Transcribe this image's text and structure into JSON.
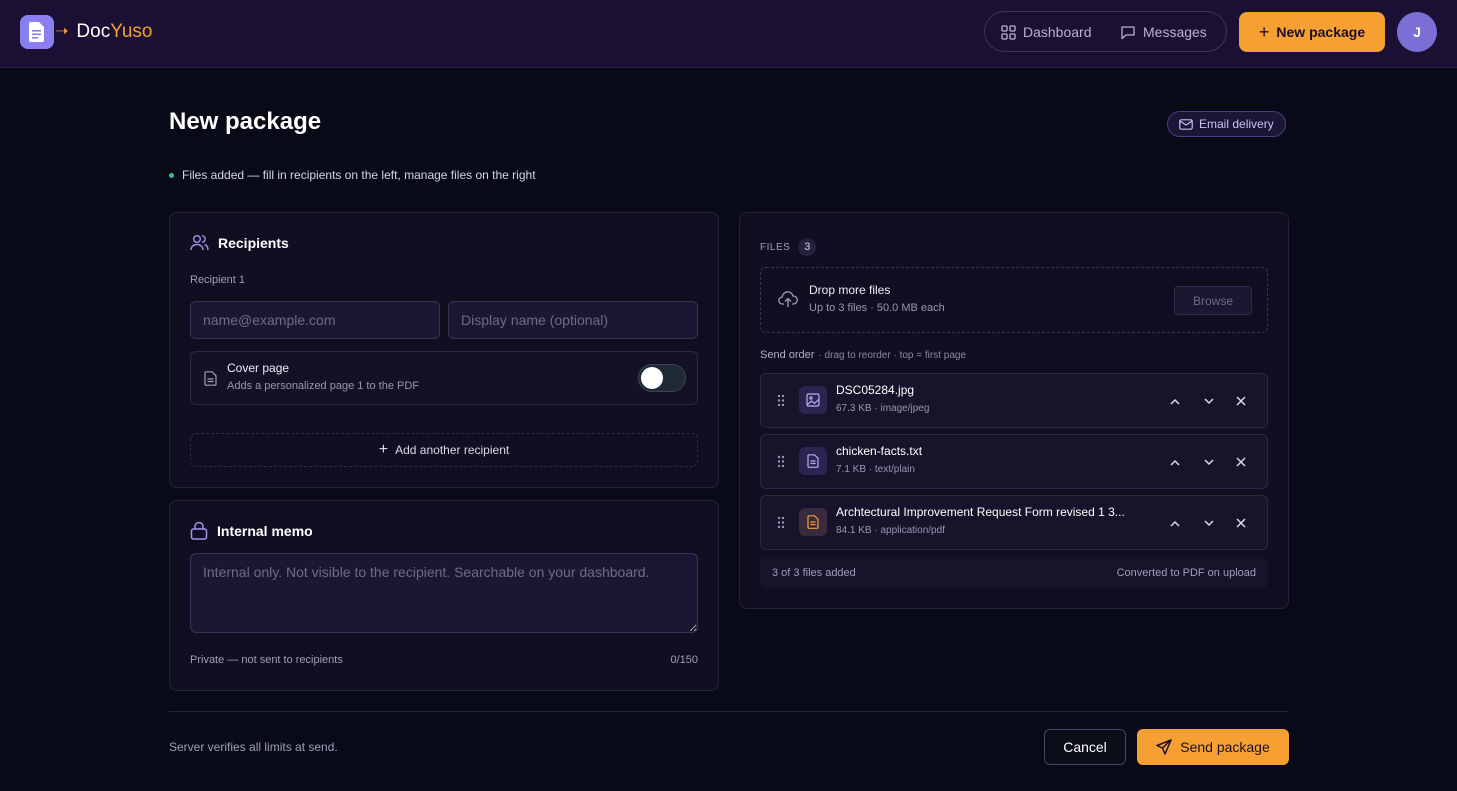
{
  "brand": {
    "name_main": "Doc",
    "name_accent": "Yuso"
  },
  "nav": {
    "dashboard_label": "Dashboard",
    "messages_label": "Messages",
    "new_package_label": "New package",
    "avatar_initial": "J"
  },
  "page": {
    "title": "New package",
    "email_badge": "Email delivery",
    "status_text": "Files added — fill in recipients on the left, manage files on the right"
  },
  "recipients": {
    "heading": "Recipients",
    "recipient_label": "Recipient 1",
    "email_placeholder": "name@example.com",
    "name_placeholder": "Display name (optional)",
    "cover_title": "Cover page",
    "cover_subtitle": "Adds a personalized page 1 to the PDF",
    "cover_enabled": false,
    "add_label": "Add another recipient"
  },
  "memo": {
    "heading": "Internal memo",
    "placeholder": "Internal only. Not visible to the recipient. Searchable on your dashboard.",
    "footer_left": "Private — not sent to recipients",
    "counter": "0/150"
  },
  "files": {
    "label": "FILES",
    "count": "3",
    "drop_title": "Drop more files",
    "drop_sub": "Up to 3 files · 50.0 MB each",
    "browse_label": "Browse",
    "order_label": "Send order",
    "order_hint": "· drag to reorder · top = first page",
    "items": [
      {
        "name": "DSC05284.jpg",
        "meta": "67.3 KB · image/jpeg",
        "icon": "image-icon"
      },
      {
        "name": "chicken-facts.txt",
        "meta": "7.1 KB · text/plain",
        "icon": "text-file-icon"
      },
      {
        "name": "Archtectural Improvement Request Form revised 1 3...",
        "meta": "84.1 KB · application/pdf",
        "icon": "pdf-file-icon"
      }
    ],
    "footer_left": "3 of 3 files added",
    "footer_right": "Converted to PDF on upload"
  },
  "footer": {
    "note": "Server verifies all limits at send.",
    "cancel_label": "Cancel",
    "send_label": "Send package"
  },
  "colors": {
    "accent": "#f6a034",
    "brand_purple": "#8a7ff0",
    "header_bg": "#1b1033",
    "page_bg": "#080b17",
    "status_green": "#2ec48a"
  }
}
